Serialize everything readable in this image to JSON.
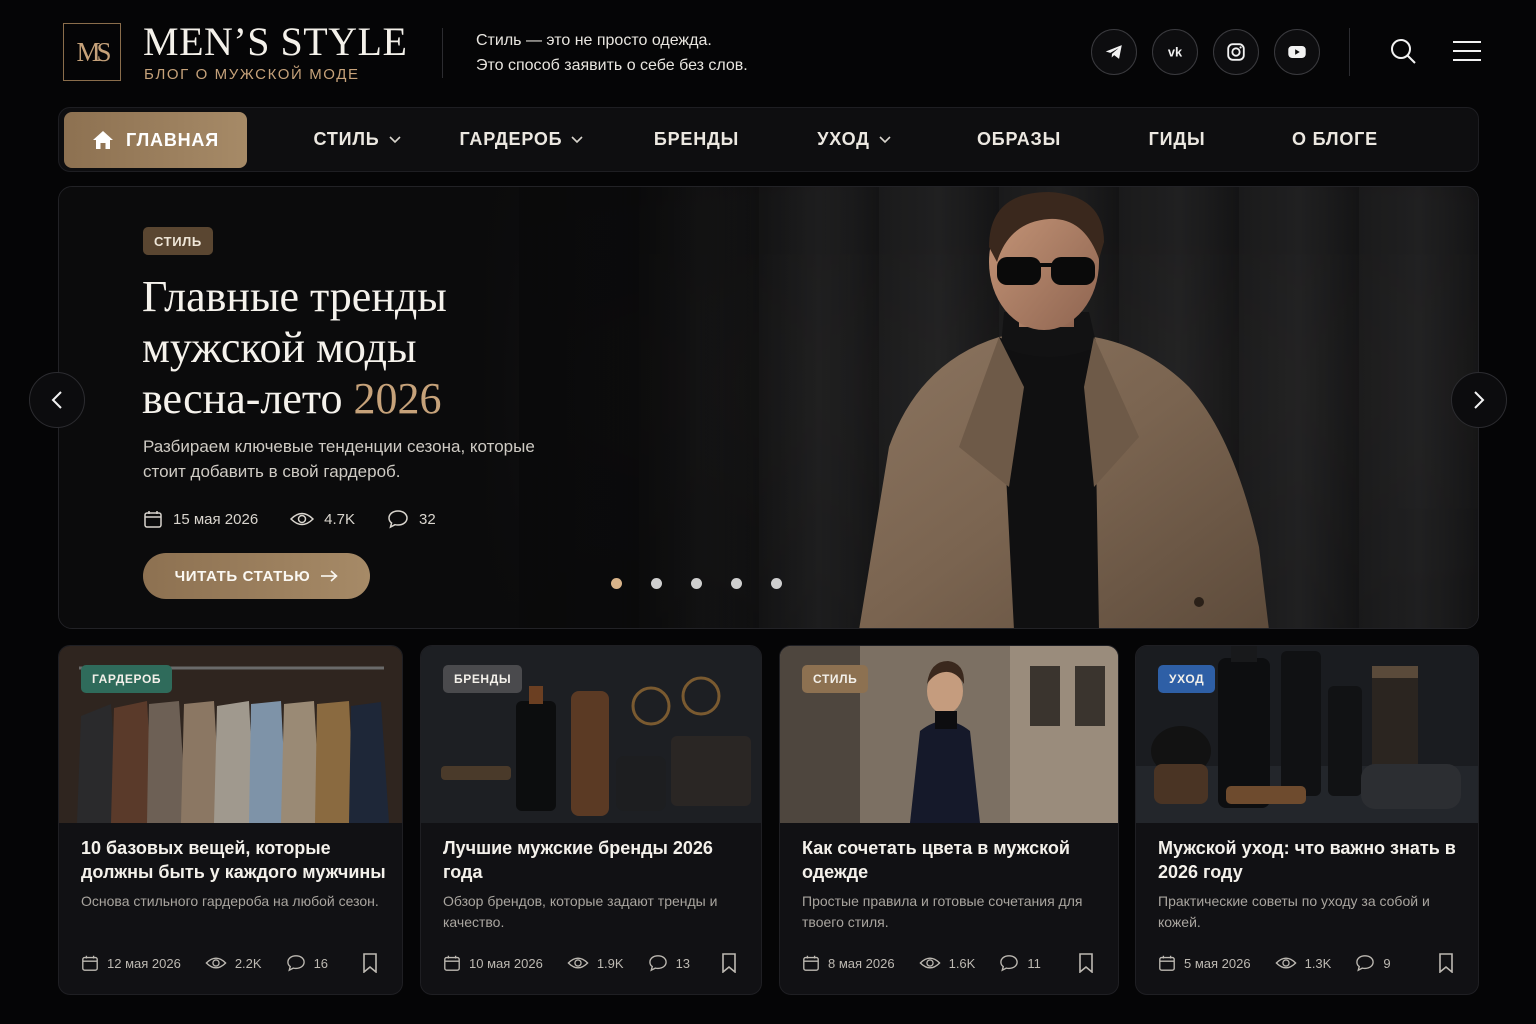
{
  "brand": {
    "logo_mark": "MS",
    "title": "MEN’S STYLE",
    "subtitle": "БЛОГ О МУЖСКОЙ МОДЕ"
  },
  "tagline": {
    "line1": "Стиль — это не просто одежда.",
    "line2": "Это способ заявить о себе без слов."
  },
  "social": [
    "telegram-icon",
    "vk-icon",
    "instagram-icon",
    "youtube-icon"
  ],
  "nav": {
    "items": [
      {
        "label": "ГЛАВНАЯ",
        "active": true,
        "dropdown": false
      },
      {
        "label": "СТИЛЬ",
        "active": false,
        "dropdown": true
      },
      {
        "label": "ГАРДЕРОБ",
        "active": false,
        "dropdown": true
      },
      {
        "label": "БРЕНДЫ",
        "active": false,
        "dropdown": false
      },
      {
        "label": "УХОД",
        "active": false,
        "dropdown": true
      },
      {
        "label": "ОБРАЗЫ",
        "active": false,
        "dropdown": false
      },
      {
        "label": "ГИДЫ",
        "active": false,
        "dropdown": false
      },
      {
        "label": "О БЛОГЕ",
        "active": false,
        "dropdown": false
      }
    ]
  },
  "hero": {
    "tag": "СТИЛЬ",
    "title_line1": "Главные тренды",
    "title_line2": "мужской моды",
    "title_line3": "весна-лето",
    "title_year": "2026",
    "description": "Разбираем ключевые тенденции сезона, которые стоит добавить в свой гардероб.",
    "date": "15 мая 2026",
    "views": "4.7K",
    "comments": "32",
    "button": "ЧИТАТЬ СТАТЬЮ",
    "slides_total": 5,
    "slide_active": 1
  },
  "cards": [
    {
      "tag": "ГАРДЕРОБ",
      "tag_color": "#2f6b5b",
      "title": "10 базовых вещей, которые должны быть у каждого мужчины",
      "description": "Основа стильного гардероба на любой сезон.",
      "date": "12 мая 2026",
      "views": "2.2K",
      "comments": "16"
    },
    {
      "tag": "БРЕНДЫ",
      "tag_color": "#4a4a4d",
      "title": "Лучшие мужские бренды 2026 года",
      "description": "Обзор брендов, которые задают тренды и качество.",
      "date": "10 мая 2026",
      "views": "1.9K",
      "comments": "13"
    },
    {
      "tag": "СТИЛЬ",
      "tag_color": "#8d7151",
      "title": "Как сочетать цвета в мужской одежде",
      "description": "Простые правила и готовые сочетания для твоего стиля.",
      "date": "8 мая 2026",
      "views": "1.6K",
      "comments": "11"
    },
    {
      "tag": "УХОД",
      "tag_color": "#2e5fa6",
      "title": "Мужской уход: что важно знать в 2026 году",
      "description": "Практические советы по уходу за собой и кожей.",
      "date": "5 мая 2026",
      "views": "1.3K",
      "comments": "9"
    }
  ]
}
